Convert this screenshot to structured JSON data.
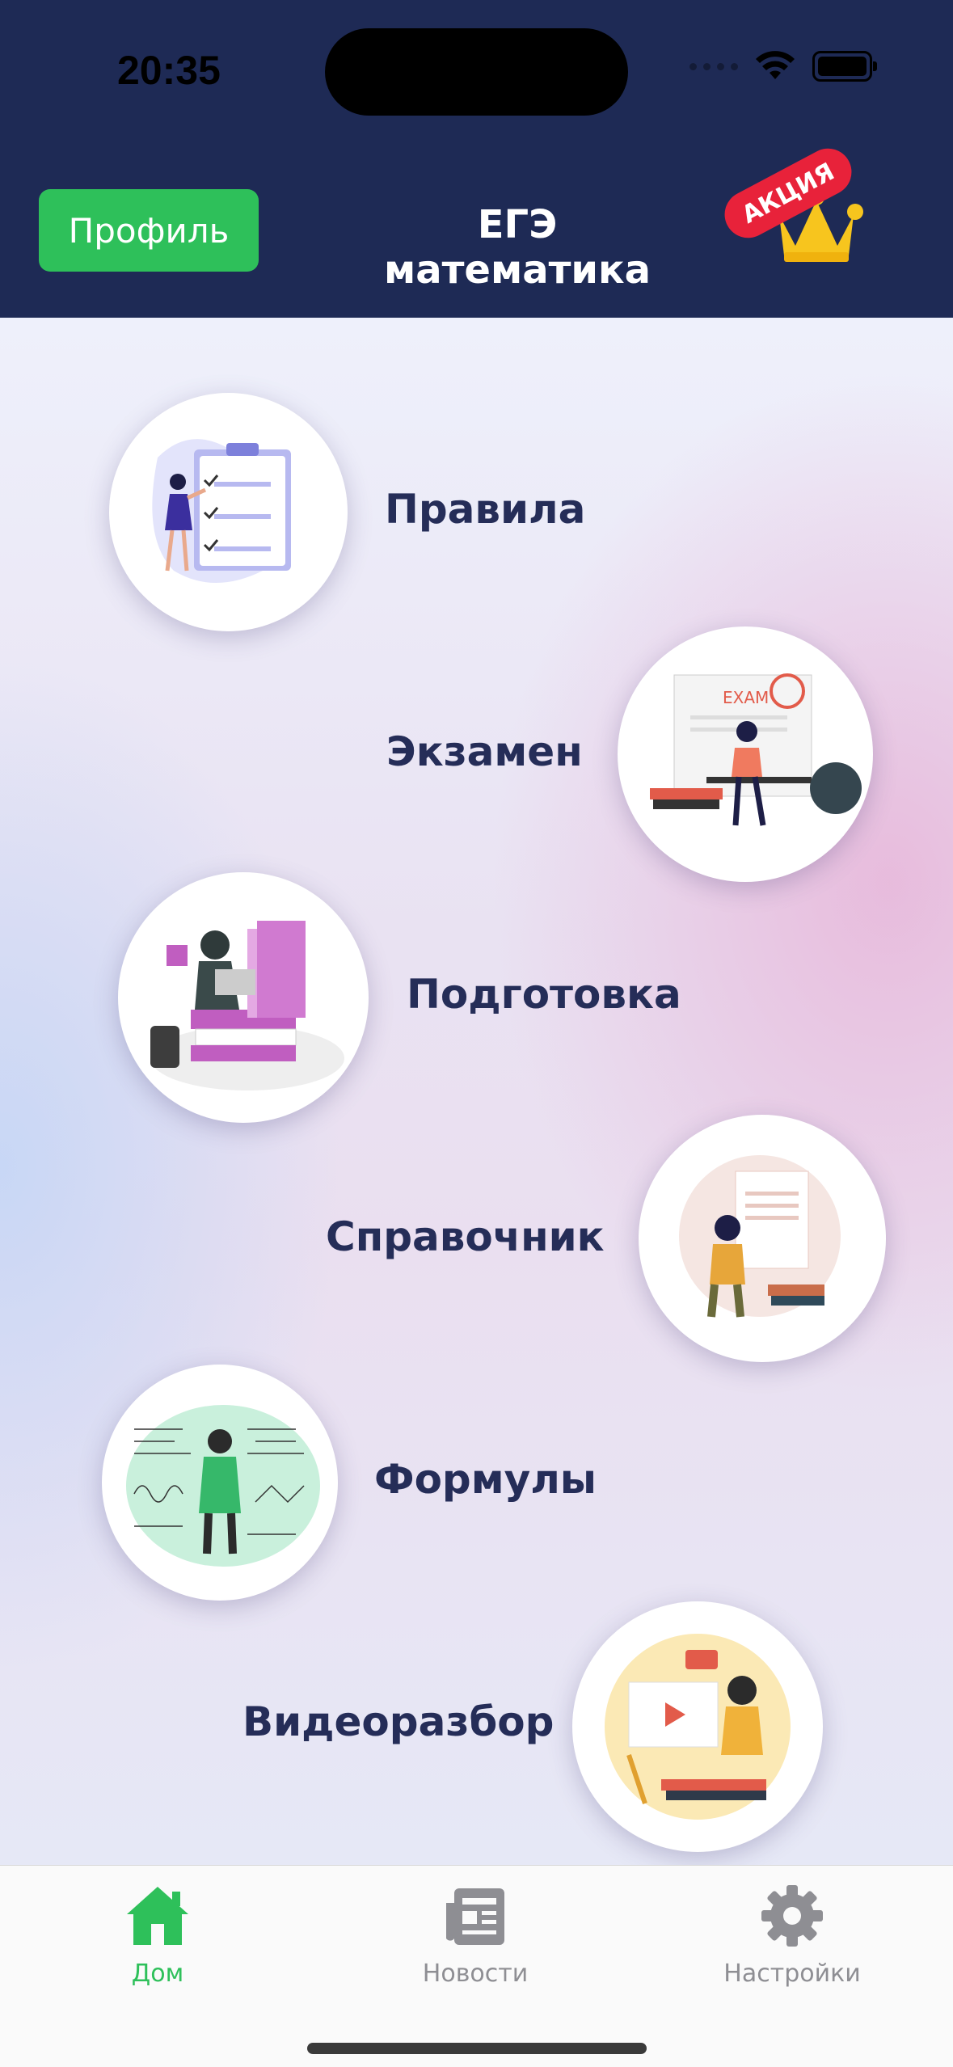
{
  "status_bar": {
    "time": "20:35"
  },
  "header": {
    "profile_label": "Профиль",
    "title": "ЕГЭ математика",
    "promo_label": "АКЦИЯ"
  },
  "menu": {
    "items": [
      {
        "label": "Правила",
        "icon": "rules-illustration"
      },
      {
        "label": "Экзамен",
        "icon": "exam-illustration"
      },
      {
        "label": "Подготовка",
        "icon": "preparation-illustration"
      },
      {
        "label": "Справочник",
        "icon": "reference-illustration"
      },
      {
        "label": "Формулы",
        "icon": "formulas-illustration"
      },
      {
        "label": "Видеоразбор",
        "icon": "video-illustration"
      }
    ]
  },
  "tabbar": {
    "tabs": [
      {
        "label": "Дом",
        "icon": "home-icon",
        "active": true
      },
      {
        "label": "Новости",
        "icon": "news-icon",
        "active": false
      },
      {
        "label": "Настройки",
        "icon": "gear-icon",
        "active": false
      }
    ]
  },
  "colors": {
    "header_bg": "#1e2a55",
    "profile_button": "#2ec05a",
    "promo_tag": "#e8223a",
    "crown": "#f7c51e",
    "label_text": "#252d58",
    "tab_active": "#2ec05a",
    "tab_inactive": "#8e8e93"
  }
}
